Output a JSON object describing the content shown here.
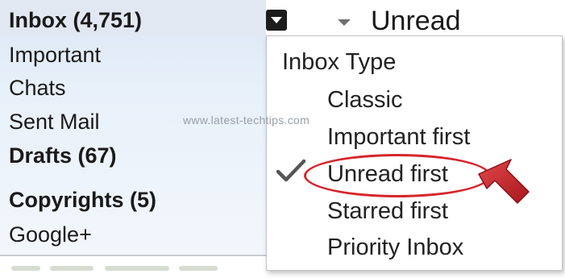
{
  "sidebar": {
    "items": [
      {
        "label": "Inbox (4,751)",
        "bold": true
      },
      {
        "label": "Important",
        "bold": false
      },
      {
        "label": "Chats",
        "bold": false
      },
      {
        "label": "Sent Mail",
        "bold": false
      },
      {
        "label": "Drafts (67)",
        "bold": true
      },
      {
        "label": "Copyrights (5)",
        "bold": true
      },
      {
        "label": "Google+",
        "bold": false
      }
    ]
  },
  "toolbar": {
    "current_view_label": "Unread"
  },
  "menu": {
    "heading": "Inbox Type",
    "options": [
      {
        "label": "Classic",
        "selected": false
      },
      {
        "label": "Important first",
        "selected": false
      },
      {
        "label": "Unread first",
        "selected": true
      },
      {
        "label": "Starred first",
        "selected": false
      },
      {
        "label": "Priority Inbox",
        "selected": false
      }
    ]
  },
  "watermark": "www.latest-techtips.com",
  "icons": {
    "dropdown_trigger": "caret-down-icon",
    "toolbar_caret": "caret-down-icon",
    "selected_mark": "checkmark-icon",
    "annotation_arrow": "arrow-icon"
  },
  "colors": {
    "annotation_red": "#d6262c",
    "sidebar_tint": "#dbe7f5"
  }
}
